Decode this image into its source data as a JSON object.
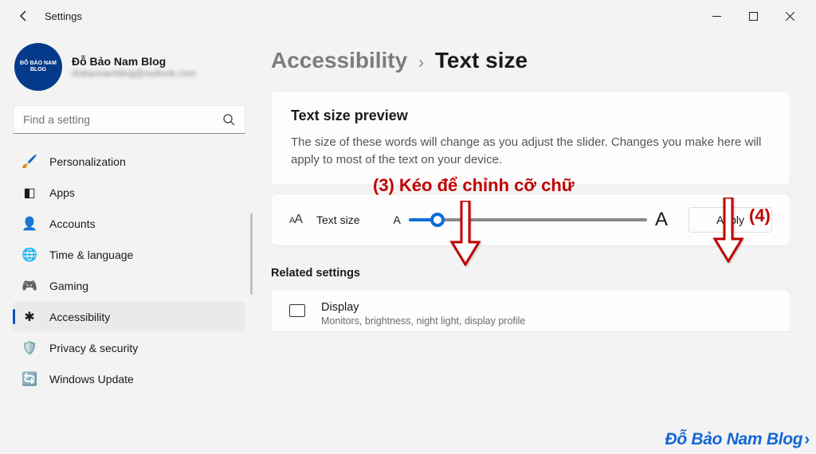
{
  "window": {
    "title": "Settings"
  },
  "profile": {
    "name": "Đỗ Bảo Nam Blog",
    "email": "dobaonamblog@outlook.com",
    "avatar_top": "ĐỖ BẢO NAM BLOG"
  },
  "search": {
    "placeholder": "Find a setting"
  },
  "sidebar": {
    "items": [
      {
        "icon": "🖌️",
        "label": "Personalization"
      },
      {
        "icon": "◧",
        "label": "Apps"
      },
      {
        "icon": "👤",
        "label": "Accounts"
      },
      {
        "icon": "🌐",
        "label": "Time & language"
      },
      {
        "icon": "🎮",
        "label": "Gaming"
      },
      {
        "icon": "✱",
        "label": "Accessibility"
      },
      {
        "icon": "🛡️",
        "label": "Privacy & security"
      },
      {
        "icon": "🔄",
        "label": "Windows Update"
      }
    ],
    "selected": 5
  },
  "breadcrumb": {
    "parent": "Accessibility",
    "sep": "›",
    "current": "Text size"
  },
  "preview": {
    "heading": "Text size preview",
    "body": "The size of these words will change as you adjust the slider. Changes you make here will apply to most of the text on your device."
  },
  "slider": {
    "label": "Text size",
    "min_symbol": "A",
    "max_symbol": "A",
    "value_percent": 12,
    "apply_label": "Apply"
  },
  "related": {
    "heading": "Related settings",
    "display": {
      "title": "Display",
      "subtitle": "Monitors, brightness, night light, display profile"
    }
  },
  "annotations": {
    "a3_num": "(3)",
    "a3_text": "Kéo để chỉnh cỡ chữ",
    "a4_num": "(4)"
  },
  "watermark": "Đỗ Bảo Nam Blog"
}
